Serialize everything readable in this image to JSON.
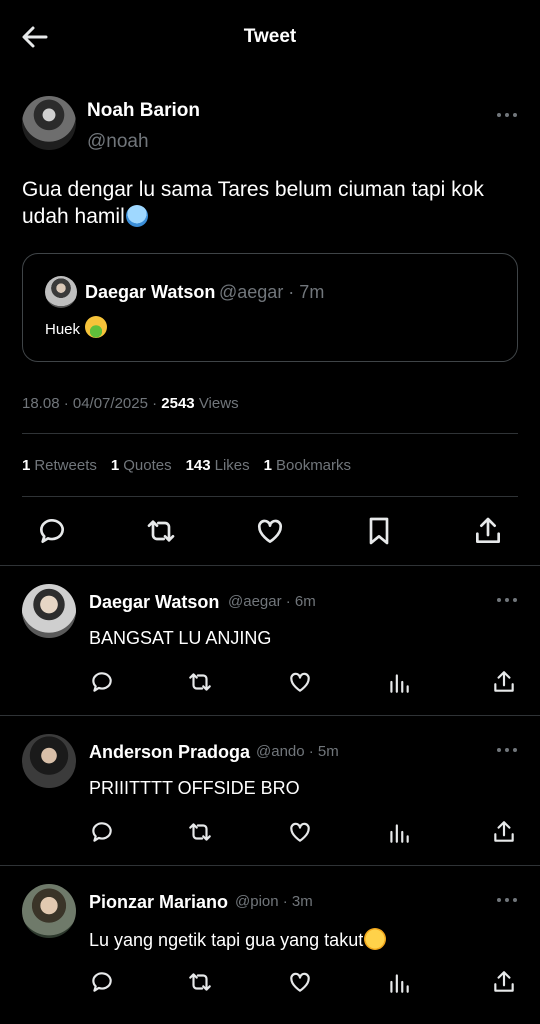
{
  "header": {
    "title": "Tweet",
    "back_icon": "arrow-left-icon"
  },
  "tweet": {
    "author_name": "Noah Barion",
    "author_handle": "@noah",
    "text": "Gua dengar lu sama Tares belum ciuman tapi kok udah hamil",
    "text_emoji": "cold-face-emoji",
    "quote": {
      "author_name": "Daegar Watson",
      "meta": "@aegar · 7m",
      "text": "Huek",
      "text_emoji": "nauseated-face-emoji"
    },
    "timestamp": "18.08 · 04/07/2025 · ",
    "views_count": "2543",
    "views_label": " Views",
    "stats": {
      "retweets_count": "1",
      "retweets_label": "Retweets",
      "quotes_count": "1",
      "quotes_label": "Quotes",
      "likes_count": "143",
      "likes_label": "Likes",
      "bookmarks_count": "1",
      "bookmarks_label": "Bookmarks"
    },
    "actions": [
      "reply-icon",
      "retweet-icon",
      "like-icon",
      "bookmark-icon",
      "share-icon"
    ]
  },
  "replies": [
    {
      "name": "Daegar Watson",
      "meta": "@aegar · 6m",
      "text": "BANGSAT LU ANJING"
    },
    {
      "name": "Anderson Pradoga",
      "meta": "@ando · 5m",
      "text": "PRIIITTTT OFFSIDE BRO"
    },
    {
      "name": "Pionzar Mariano",
      "meta": "@pion · 3m",
      "text": "Lu yang ngetik tapi gua yang takut",
      "text_emoji": "upside-down-face-emoji"
    }
  ],
  "colors": {
    "background": "#000000",
    "text": "#e7e9ea",
    "muted": "#71767b",
    "border": "#2f3336"
  }
}
